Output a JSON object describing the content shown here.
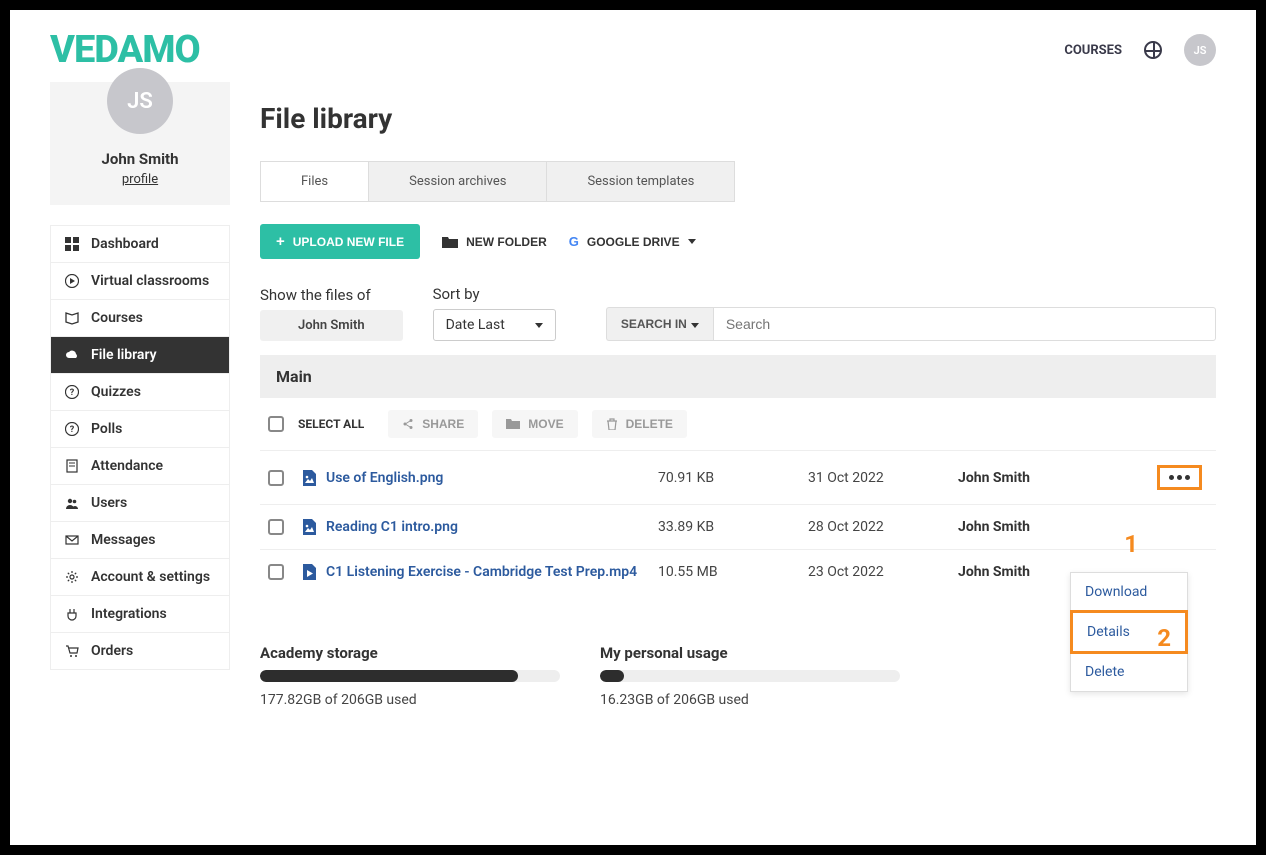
{
  "brand": "VEDAMO",
  "top_nav": {
    "courses": "COURSES"
  },
  "user": {
    "initials": "JS",
    "name": "John Smith",
    "profile_link": "profile"
  },
  "sidebar": {
    "items": [
      {
        "label": "Dashboard"
      },
      {
        "label": "Virtual classrooms"
      },
      {
        "label": "Courses"
      },
      {
        "label": "File library"
      },
      {
        "label": "Quizzes"
      },
      {
        "label": "Polls"
      },
      {
        "label": "Attendance"
      },
      {
        "label": "Users"
      },
      {
        "label": "Messages"
      },
      {
        "label": "Account & settings"
      },
      {
        "label": "Integrations"
      },
      {
        "label": "Orders"
      }
    ]
  },
  "page": {
    "title": "File library",
    "tabs": [
      {
        "label": "Files"
      },
      {
        "label": "Session archives"
      },
      {
        "label": "Session templates"
      }
    ],
    "actions": {
      "upload": "UPLOAD NEW FILE",
      "new_folder": "NEW FOLDER",
      "google_drive": "GOOGLE DRIVE"
    },
    "filters": {
      "show_label": "Show the files of",
      "show_value": "John Smith",
      "sort_label": "Sort by",
      "sort_value": "Date Last",
      "search_in": "SEARCH IN",
      "search_placeholder": "Search"
    },
    "section": "Main",
    "batch": {
      "select_all": "SELECT ALL",
      "share": "SHARE",
      "move": "MOVE",
      "delete": "DELETE"
    },
    "files": [
      {
        "name": "Use of English.png",
        "size": "70.91 KB",
        "date": "31 Oct 2022",
        "owner": "John Smith"
      },
      {
        "name": "Reading C1 intro.png",
        "size": "33.89 KB",
        "date": "28 Oct 2022",
        "owner": "John Smith"
      },
      {
        "name": "C1 Listening Exercise - Cambridge Test Prep.mp4",
        "size": "10.55 MB",
        "date": "23 Oct 2022",
        "owner": "John Smith"
      }
    ],
    "row_menu": {
      "download": "Download",
      "details": "Details",
      "delete": "Delete"
    },
    "callouts": {
      "one": "1",
      "two": "2"
    },
    "storage": {
      "academy_label": "Academy storage",
      "academy_text": "177.82GB of 206GB used",
      "academy_pct": 86,
      "personal_label": "My personal usage",
      "personal_text": "16.23GB of 206GB used",
      "personal_pct": 8
    }
  }
}
